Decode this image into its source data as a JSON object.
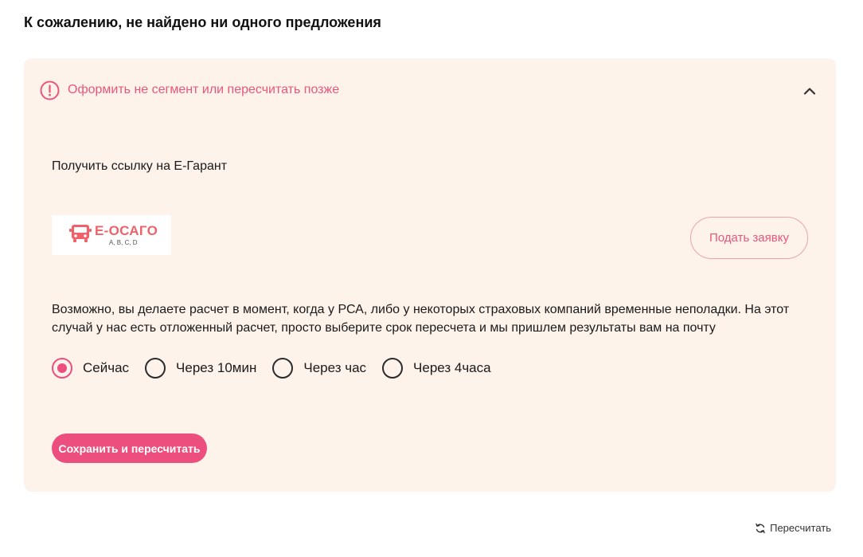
{
  "page": {
    "title": "К сожалению, не найдено ни одного предложения"
  },
  "panel": {
    "warning_text": "Оформить не сегмент или пересчитать позже",
    "link_label": "Получить ссылку на Е-Гарант",
    "logo": {
      "title": "Е-ОСАГО",
      "subtitle": "A, B, C, D"
    },
    "apply_button": "Подать заявку",
    "info_text": "Возможно, вы делаете расчет в момент, когда у РСА, либо у некоторых страховых компаний временные неполадки. На этот случай у нас есть отложенный расчет, просто выберите срок пересчета и мы пришлем результаты вам на почту",
    "options": [
      {
        "label": "Сейчас",
        "checked": true
      },
      {
        "label": "Через 10мин",
        "checked": false
      },
      {
        "label": "Через час",
        "checked": false
      },
      {
        "label": "Через 4часа",
        "checked": false
      }
    ],
    "save_button": "Сохранить и пересчитать"
  },
  "footer": {
    "recalc_label": "Пересчитать"
  },
  "colors": {
    "accent": "#ec4f7e",
    "panel_bg": "#fdf3ea",
    "warning": "#e8577a",
    "logo_red": "#f0626a"
  },
  "icons": {
    "warning": "exclamation-circle-icon",
    "collapse": "chevron-up-icon",
    "logo": "bus-icon",
    "recalc": "refresh-icon"
  }
}
